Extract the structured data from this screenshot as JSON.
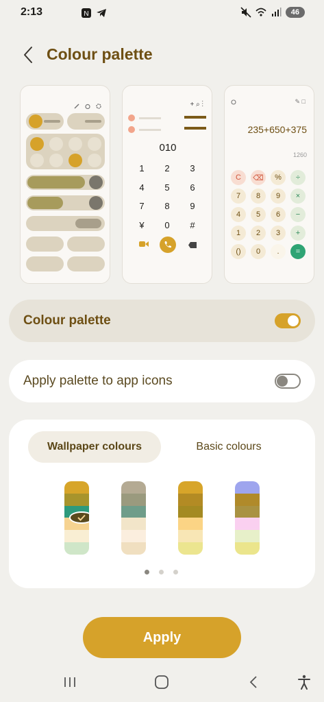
{
  "status_bar": {
    "time": "2:13",
    "battery": "46"
  },
  "header": {
    "title": "Colour palette"
  },
  "previews": {
    "dialer": {
      "number": "010",
      "keys": [
        "1",
        "2",
        "3",
        "4",
        "5",
        "6",
        "7",
        "8",
        "9",
        "¥",
        "0",
        "#"
      ]
    },
    "calculator": {
      "expression": "235+650+375",
      "result": "1260",
      "keys": [
        "C",
        "⌫",
        "%",
        "÷",
        "7",
        "8",
        "9",
        "×",
        "4",
        "5",
        "6",
        "−",
        "1",
        "2",
        "3",
        "+",
        "()",
        "0",
        ".",
        "="
      ]
    }
  },
  "colour_palette_row": {
    "label": "Colour palette",
    "enabled": true
  },
  "app_icons_row": {
    "label": "Apply palette to app icons",
    "enabled": false
  },
  "palette_panel": {
    "tabs": [
      {
        "label": "Wallpaper colours",
        "selected": true
      },
      {
        "label": "Basic colours",
        "selected": false
      }
    ],
    "swatches": [
      {
        "colors": [
          "#d7a52a",
          "#a8942c",
          "#2e9a7c",
          "#f6d391",
          "#f9eed3",
          "#cfe6c8"
        ],
        "selected": true
      },
      {
        "colors": [
          "#b4aa93",
          "#9a9a7e",
          "#6f9d8a",
          "#f2e5c9",
          "#fbeede",
          "#f0dfc0"
        ],
        "selected": false
      },
      {
        "colors": [
          "#d7a52a",
          "#b38b24",
          "#a48a22",
          "#fbd485",
          "#f8e6b5",
          "#ece58f"
        ],
        "selected": false
      },
      {
        "colors": [
          "#9ea5ee",
          "#b08a2a",
          "#a99242",
          "#fad0f0",
          "#e7f0c9",
          "#ebe58c"
        ],
        "selected": false
      }
    ],
    "page_count": 3,
    "current_page": 0
  },
  "apply_button": {
    "label": "Apply"
  },
  "colors": {
    "accent": "#d6a22a",
    "title": "#6e4f13",
    "check": "#5a4a1e"
  }
}
